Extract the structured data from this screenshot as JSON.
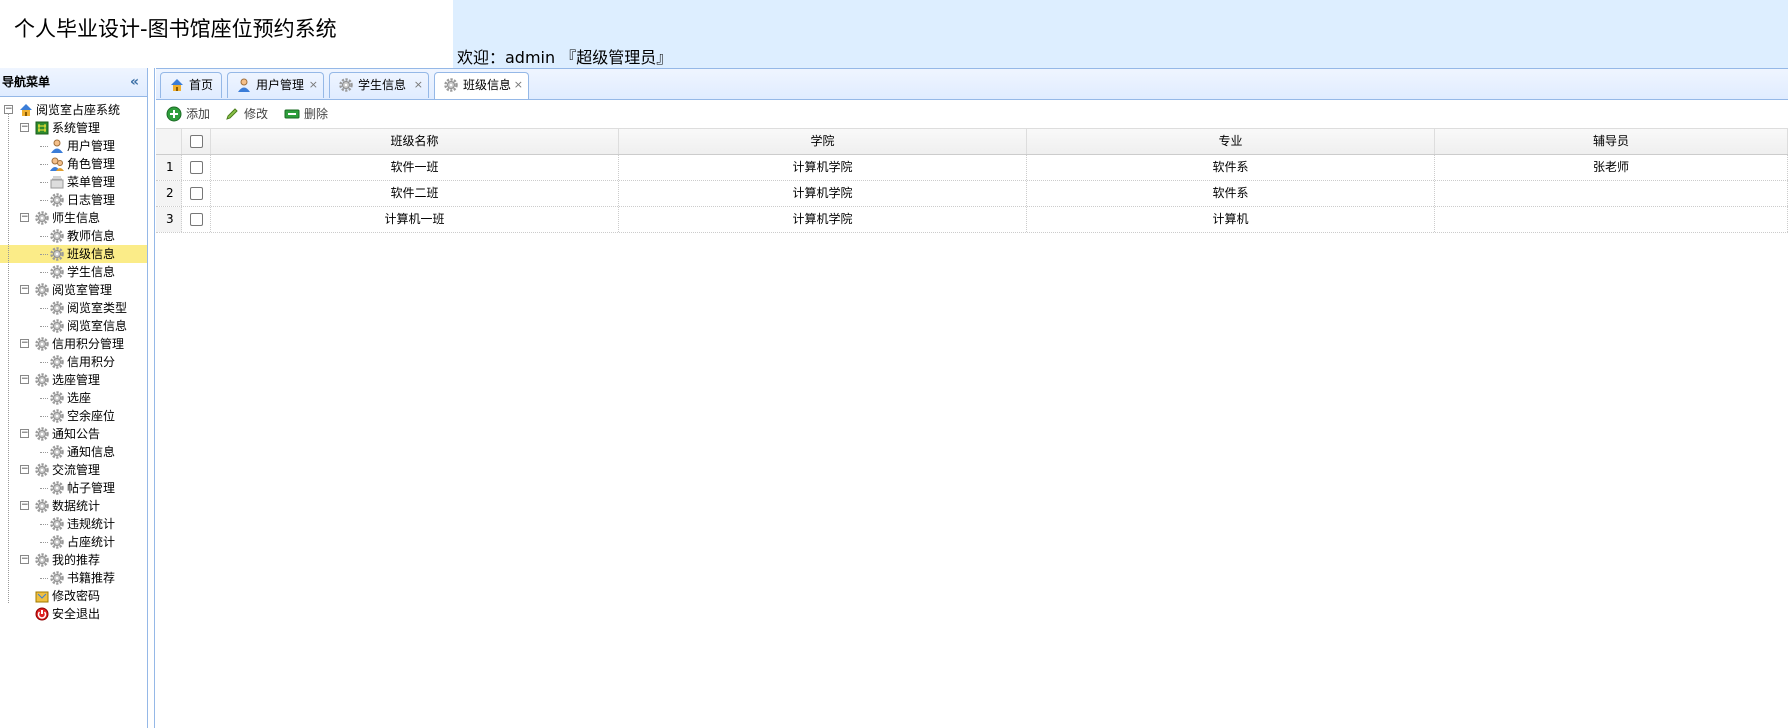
{
  "header": {
    "title": "个人毕业设计-图书馆座位预约系统",
    "welcome": "欢迎：admin 『超级管理员』"
  },
  "sidebar": {
    "title": "导航菜单",
    "collapse_icon": "double-chevron-left-icon",
    "tree": [
      {
        "label": "阅览室占座系统",
        "level": 0,
        "icon": "home-icon",
        "toggle": "⊟"
      },
      {
        "label": "系统管理",
        "level": 1,
        "icon": "grid-icon",
        "toggle": "⊟"
      },
      {
        "label": "用户管理",
        "level": 2,
        "icon": "user-icon"
      },
      {
        "label": "角色管理",
        "level": 2,
        "icon": "users-icon"
      },
      {
        "label": "菜单管理",
        "level": 2,
        "icon": "menu-icon"
      },
      {
        "label": "日志管理",
        "level": 2,
        "icon": "gear-icon"
      },
      {
        "label": "师生信息",
        "level": 1,
        "icon": "gear-icon",
        "toggle": "⊟"
      },
      {
        "label": "教师信息",
        "level": 2,
        "icon": "gear-icon"
      },
      {
        "label": "班级信息",
        "level": 2,
        "icon": "gear-icon",
        "selected": true
      },
      {
        "label": "学生信息",
        "level": 2,
        "icon": "gear-icon"
      },
      {
        "label": "阅览室管理",
        "level": 1,
        "icon": "gear-icon",
        "toggle": "⊟"
      },
      {
        "label": "阅览室类型",
        "level": 2,
        "icon": "gear-icon"
      },
      {
        "label": "阅览室信息",
        "level": 2,
        "icon": "gear-icon"
      },
      {
        "label": "信用积分管理",
        "level": 1,
        "icon": "gear-icon",
        "toggle": "⊟"
      },
      {
        "label": "信用积分",
        "level": 2,
        "icon": "gear-icon"
      },
      {
        "label": "选座管理",
        "level": 1,
        "icon": "gear-icon",
        "toggle": "⊟"
      },
      {
        "label": "选座",
        "level": 2,
        "icon": "gear-icon"
      },
      {
        "label": "空余座位",
        "level": 2,
        "icon": "gear-icon"
      },
      {
        "label": "通知公告",
        "level": 1,
        "icon": "gear-icon",
        "toggle": "⊟"
      },
      {
        "label": "通知信息",
        "level": 2,
        "icon": "gear-icon"
      },
      {
        "label": "交流管理",
        "level": 1,
        "icon": "gear-icon",
        "toggle": "⊟"
      },
      {
        "label": "帖子管理",
        "level": 2,
        "icon": "gear-icon"
      },
      {
        "label": "数据统计",
        "level": 1,
        "icon": "gear-icon",
        "toggle": "⊟"
      },
      {
        "label": "违规统计",
        "level": 2,
        "icon": "gear-icon"
      },
      {
        "label": "占座统计",
        "level": 2,
        "icon": "gear-icon"
      },
      {
        "label": "我的推荐",
        "level": 1,
        "icon": "gear-icon",
        "toggle": "⊟"
      },
      {
        "label": "书籍推荐",
        "level": 2,
        "icon": "gear-icon"
      },
      {
        "label": "修改密码",
        "level": 1,
        "icon": "password-icon"
      },
      {
        "label": "安全退出",
        "level": 1,
        "icon": "exit-icon"
      }
    ]
  },
  "tabs": [
    {
      "label": "首页",
      "icon": "home-icon",
      "closable": false,
      "active": false
    },
    {
      "label": "用户管理",
      "icon": "user-icon",
      "closable": true,
      "active": false
    },
    {
      "label": "学生信息",
      "icon": "gear-icon",
      "closable": true,
      "active": false
    },
    {
      "label": "班级信息",
      "icon": "gear-icon",
      "closable": true,
      "active": true
    }
  ],
  "tab_close_glyph": "×",
  "toolbar": {
    "add_label": "添加",
    "edit_label": "修改",
    "delete_label": "删除"
  },
  "grid": {
    "columns": [
      "班级名称",
      "学院",
      "专业",
      "辅导员"
    ],
    "rows": [
      {
        "num": "1",
        "cells": [
          "软件一班",
          "计算机学院",
          "软件系",
          "张老师"
        ]
      },
      {
        "num": "2",
        "cells": [
          "软件二班",
          "计算机学院",
          "软件系",
          ""
        ]
      },
      {
        "num": "3",
        "cells": [
          "计算机一班",
          "计算机学院",
          "计算机",
          ""
        ]
      }
    ]
  },
  "colors": {
    "header_bg": "#ddeeff",
    "panel_border": "#95b8e7",
    "selected_row": "#fbec88"
  }
}
